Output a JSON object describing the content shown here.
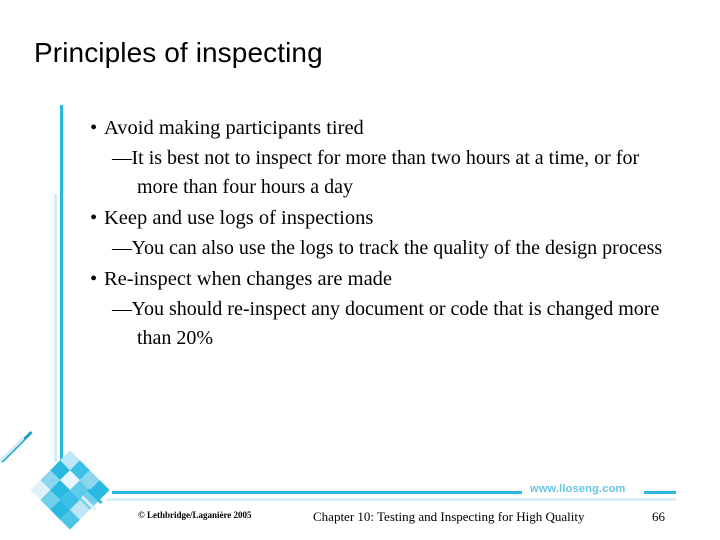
{
  "slide": {
    "title": "Principles of inspecting",
    "page_number": "66",
    "accent_color": "#29b9e0",
    "accent_pale_color": "#d5eef6",
    "url_color": "#63c6e6"
  },
  "content": {
    "bullets": [
      {
        "marker": "•",
        "text": "Avoid making participants tired",
        "sub": [
          {
            "marker": "—",
            "text": "It is best not to inspect for more than two hours at a time, or for more than four hours a day"
          }
        ]
      },
      {
        "marker": "•",
        "text": "Keep and use logs of inspections",
        "sub": [
          {
            "marker": "—",
            "text": "You can also use the logs to track the quality of the design process"
          }
        ]
      },
      {
        "marker": "•",
        "text": "Re-inspect when changes are made",
        "sub": [
          {
            "marker": "—",
            "text": "You should re-inspect any document or code that is changed more than 20%"
          }
        ]
      }
    ]
  },
  "footer": {
    "url": "www.lloseng.com",
    "copyright": "© Lethbridge/Laganière 2005",
    "chapter": "Chapter 10: Testing and Inspecting for High Quality",
    "page_number": "66"
  },
  "decoration": {
    "diamond_tiles": [
      "#bfe6f5",
      "#3dc0e8",
      "#8ed6ef",
      "#29b9e0",
      "#29b9e0",
      "#e8f6fb",
      "#5fcbe9",
      "#6fcfec",
      "#8ed6ef",
      "#29b9e0",
      "#3dc0e8",
      "#bfe6f5",
      "#dff2fa",
      "#6fcfec",
      "#29b9e0",
      "#4ec5e7"
    ]
  }
}
